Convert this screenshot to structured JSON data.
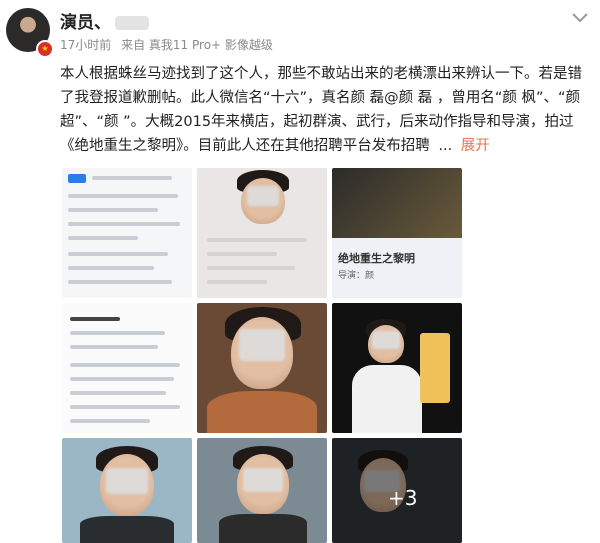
{
  "header": {
    "username": "演员、",
    "time": "17小时前",
    "source": "来自 真我11 Pro+ 影像越级"
  },
  "post": {
    "text": "本人根据蛛丝马迹找到了这个人，那些不敢站出来的老横漂出来辨认一下。若是错了我登报道歉删帖。此人微信名“十六”，真名颜 磊@颜 磊 ，曾用名“颜 枫”、“颜 超”、“颜 ”。大概2015年来横店，起初群演、武行，后来动作指导和导演，拍过《绝地重生之黎明》。目前此人还在其他招聘平台发布招聘",
    "ellipsis": "...",
    "expand": "展开"
  },
  "images": {
    "more_count": "+3",
    "t3_title": "绝地重生之黎明",
    "t3_sub": "导演：颜 "
  },
  "colors": {
    "accent": "#eb7350",
    "meta": "#8a8a8a"
  }
}
